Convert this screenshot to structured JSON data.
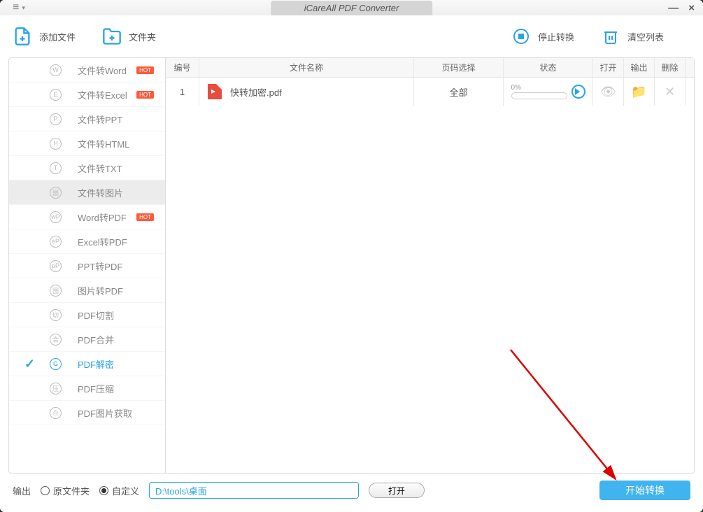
{
  "window": {
    "title": "iCareAll PDF Converter"
  },
  "toolbar": {
    "add_file": "添加文件",
    "add_folder": "文件夹",
    "stop": "停止转换",
    "clear": "清空列表"
  },
  "sidebar": {
    "items": [
      {
        "icon": "W",
        "label": "文件转Word",
        "hot": "HOT"
      },
      {
        "icon": "E",
        "label": "文件转Excel",
        "hot": "HOT"
      },
      {
        "icon": "P",
        "label": "文件转PPT"
      },
      {
        "icon": "H",
        "label": "文件转HTML"
      },
      {
        "icon": "T",
        "label": "文件转TXT"
      },
      {
        "icon": "图",
        "label": "文件转图片",
        "image_row": true
      },
      {
        "icon": "wP",
        "label": "Word转PDF",
        "hot": "HOT"
      },
      {
        "icon": "eP",
        "label": "Excel转PDF"
      },
      {
        "icon": "pP",
        "label": "PPT转PDF"
      },
      {
        "icon": "图",
        "label": "图片转PDF"
      },
      {
        "icon": "切",
        "label": "PDF切割"
      },
      {
        "icon": "合",
        "label": "PDF合并"
      },
      {
        "icon": "G",
        "label": "PDF解密",
        "active": true
      },
      {
        "icon": "压",
        "label": "PDF压缩"
      },
      {
        "icon": "⎙",
        "label": "PDF图片获取"
      }
    ]
  },
  "table": {
    "headers": {
      "num": "编号",
      "name": "文件名称",
      "page": "页码选择",
      "status": "状态",
      "open": "打开",
      "output": "输出",
      "delete": "删除"
    },
    "rows": [
      {
        "num": "1",
        "name": "快转加密.pdf",
        "page": "全部",
        "progress": "0%"
      }
    ]
  },
  "footer": {
    "output_label": "输出",
    "radio_original": "原文件夹",
    "radio_custom": "自定义",
    "path": "D:\\tools\\桌面",
    "open_btn": "打开",
    "start_btn": "开始转换"
  }
}
